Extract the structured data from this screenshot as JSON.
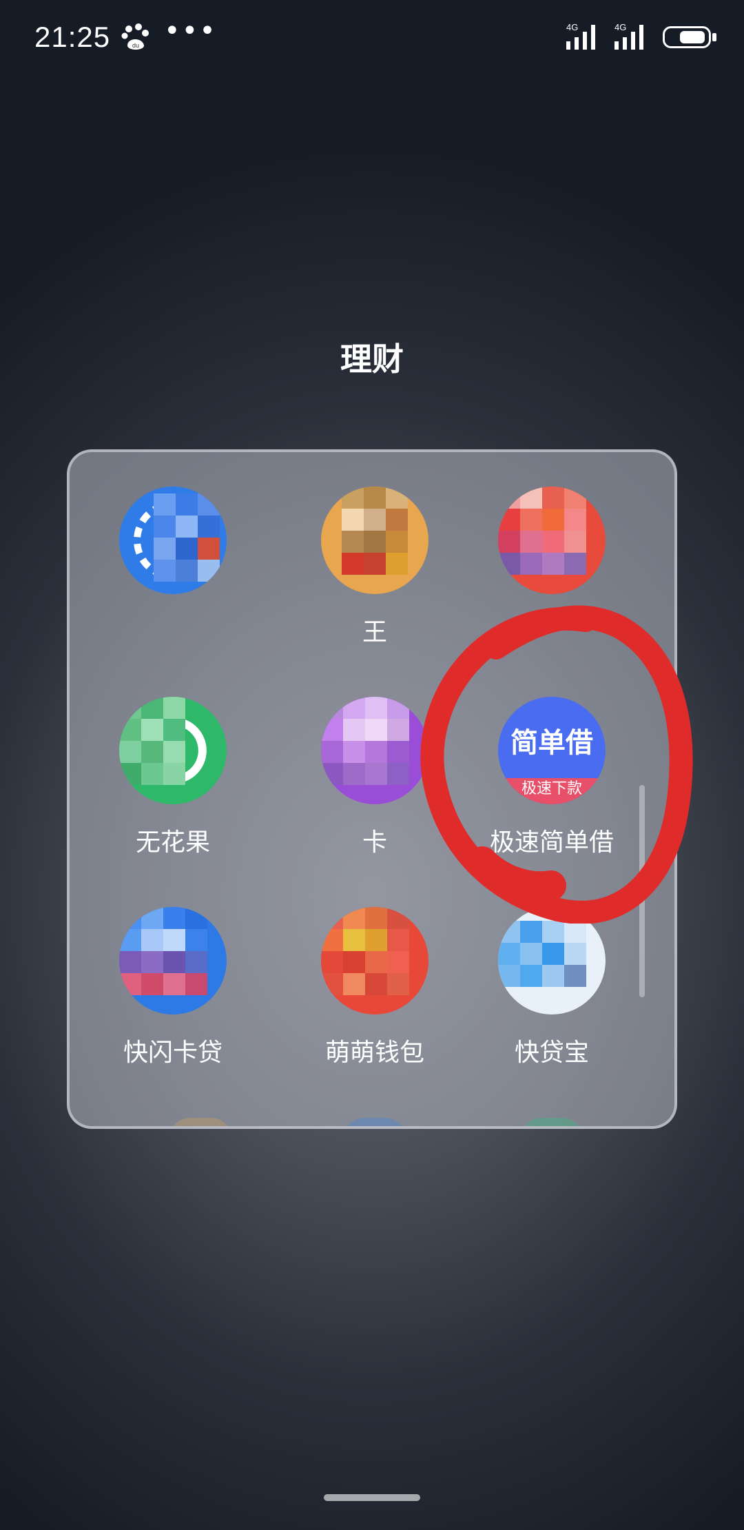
{
  "status_bar": {
    "time": "21:25",
    "dots": "•••",
    "signal1_label": "4G",
    "signal2_label": "4G"
  },
  "folder": {
    "title": "理财",
    "apps": [
      {
        "label": "",
        "icon": "blue-app-icon"
      },
      {
        "label": "王",
        "icon": "cartoon-app-icon"
      },
      {
        "label": "",
        "icon": "red-app-icon"
      },
      {
        "label": "无花果",
        "icon": "green-app-icon"
      },
      {
        "label": "卡",
        "icon": "purple-app-icon"
      },
      {
        "label": "极速简单借",
        "icon": "jiandanjie-icon",
        "icon_text": "简单借",
        "icon_sub": "极速下款"
      },
      {
        "label": "快闪卡贷",
        "icon": "blue-flash-icon"
      },
      {
        "label": "萌萌钱包",
        "icon": "red-wallet-icon"
      },
      {
        "label": "快贷宝",
        "icon": "light-blue-icon"
      }
    ]
  },
  "colors": {
    "annotation": "#e02b2b",
    "jiandanjie_bg": "#4a6cf0"
  }
}
